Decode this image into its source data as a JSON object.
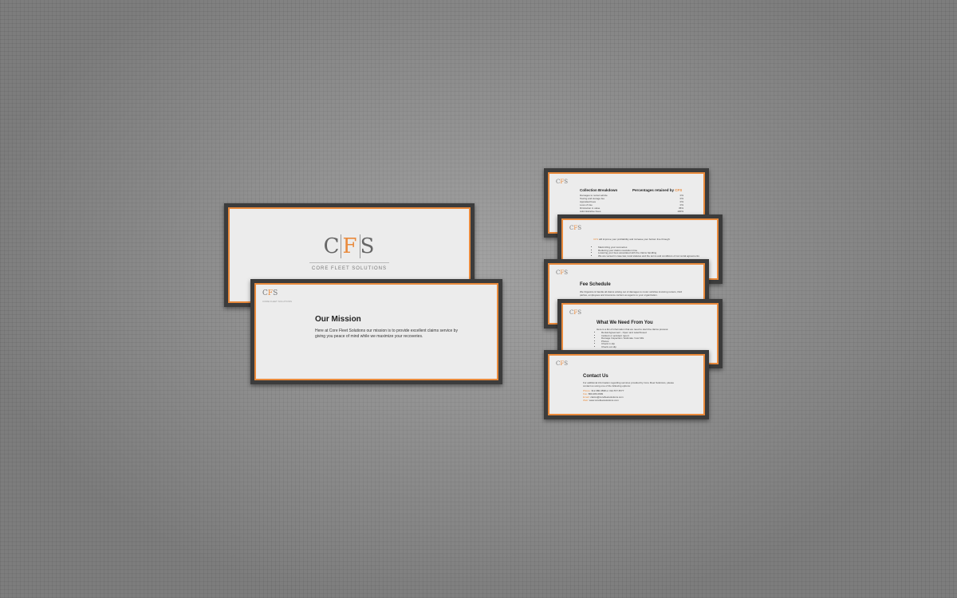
{
  "brand": {
    "logo_c": "C",
    "logo_f": "F",
    "logo_s": "S",
    "name": "CORE FLEET SOLUTIONS",
    "abbr": "CFS"
  },
  "mission": {
    "title": "Our Mission",
    "text": "Here at Core Fleet Solutions our mission is to provide excellent claims service by giving you peace of mind while we maximize your recoveries."
  },
  "collection": {
    "heading_left": "Collection Breakdown",
    "heading_right": "Percentages retained by",
    "items": [
      {
        "label": "Damages to rental vehicle",
        "value": "0%"
      },
      {
        "label": "Towing and storage fee",
        "value": "0%"
      },
      {
        "label": "Appraisal Fees",
        "value": "0%"
      },
      {
        "label": "Loss of Use",
        "value": "0%"
      },
      {
        "label": "Diminution in value",
        "value": "35%"
      },
      {
        "label": "Administrative Fees",
        "value": "100%"
      }
    ]
  },
  "benefits": {
    "intro": "will improve your profitability and increase your bottom line through:",
    "items": [
      "Maximizing your recoveries",
      "Reducing your claims resolution time",
      "Lowering your fees associated with the claims handling",
      "We are versed in case law, local statutes and the terms and conditions of car rental agreements"
    ]
  },
  "fees": {
    "title": "Fee Schedule",
    "text": "We Organize & handle all claims arising out of damages to motor vehicles involving renters, third parties, employees and insurance carriers as agents to your organization."
  },
  "needs": {
    "title": "What We Need From You",
    "intro": "Here is a list of information that we need to start the claims process:",
    "items": [
      "Rental Agreement - Open and Late/Closed",
      "Incident or accident report",
      "Damage Inspection / Estimate / tow bills",
      "Photos",
      "Check in slip",
      "Check out slip"
    ]
  },
  "contact": {
    "title": "Contact Us",
    "text": "For additional information regarding services provided by Core Fleet Solutions, please contact us using one of the following options:",
    "phone_label": "Phone:",
    "phone_value": "312.380.3838 or 312.577.8777",
    "fax_label": "Fax:",
    "fax_value": "800.283.2999",
    "email_label": "Email:",
    "email_value": "claims@corefleetsolutions.com",
    "web_label": "Web:",
    "web_value": "www.corefleetsolutions.com"
  },
  "colors": {
    "accent": "#e98a3c",
    "frame": "#3c3c3c",
    "paper": "#ececec"
  }
}
